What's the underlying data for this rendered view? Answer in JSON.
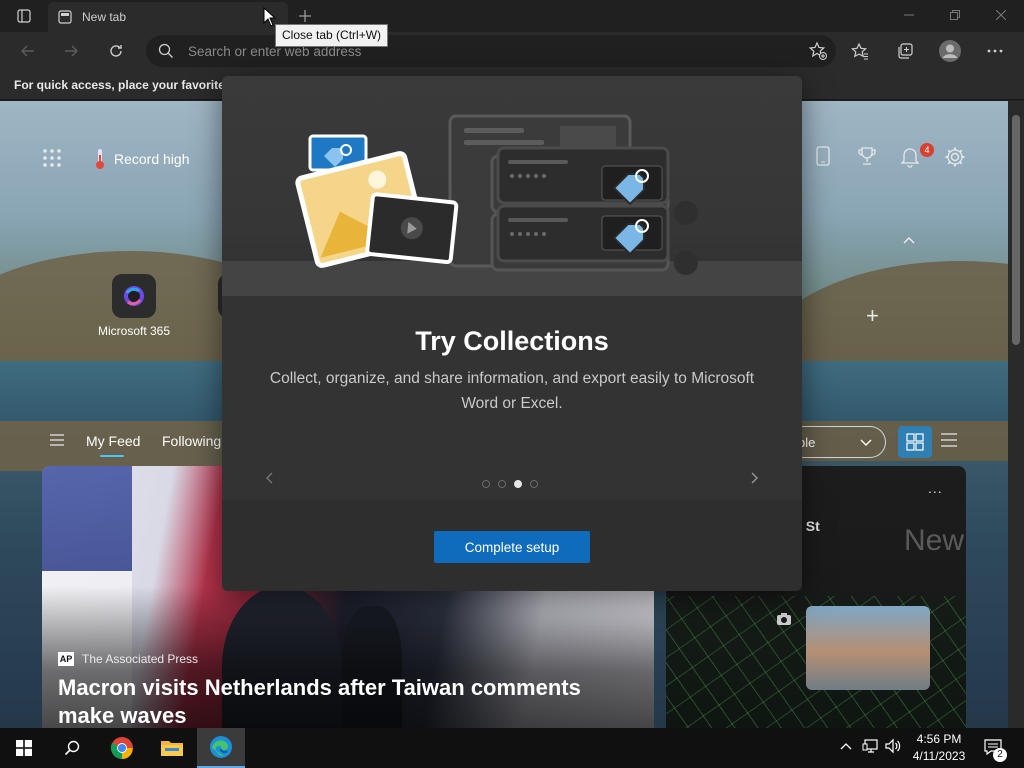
{
  "browser": {
    "tab_title": "New tab",
    "tooltip": "Close tab (Ctrl+W)",
    "address_placeholder": "Search or enter web address",
    "favorites_bar_text": "For quick access, place your favorites h"
  },
  "newtab": {
    "weather": "Record high",
    "notification_count": "4",
    "tile_label": "Microsoft 365",
    "feed_tabs": [
      "My Feed",
      "Following"
    ],
    "language_selector": "ple",
    "card_main": {
      "source": "The Associated Press",
      "source_logo": "AP",
      "headline": "Macron visits Netherlands after Taiwan comments make waves"
    },
    "card_side": {
      "more": "...",
      "street_text": "l St",
      "corner_text": "New"
    }
  },
  "dialog": {
    "title": "Try Collections",
    "description": "Collect, organize, and share information, and export easily to Microsoft Word or Excel.",
    "button": "Complete setup",
    "pager_total": 4,
    "pager_active": 3
  },
  "taskbar": {
    "time": "4:56 PM",
    "date": "4/11/2023",
    "notification_count": "2"
  },
  "colors": {
    "accent": "#0f6cbd",
    "badge": "#d8412f",
    "feed_underline": "#4cc2ff"
  }
}
